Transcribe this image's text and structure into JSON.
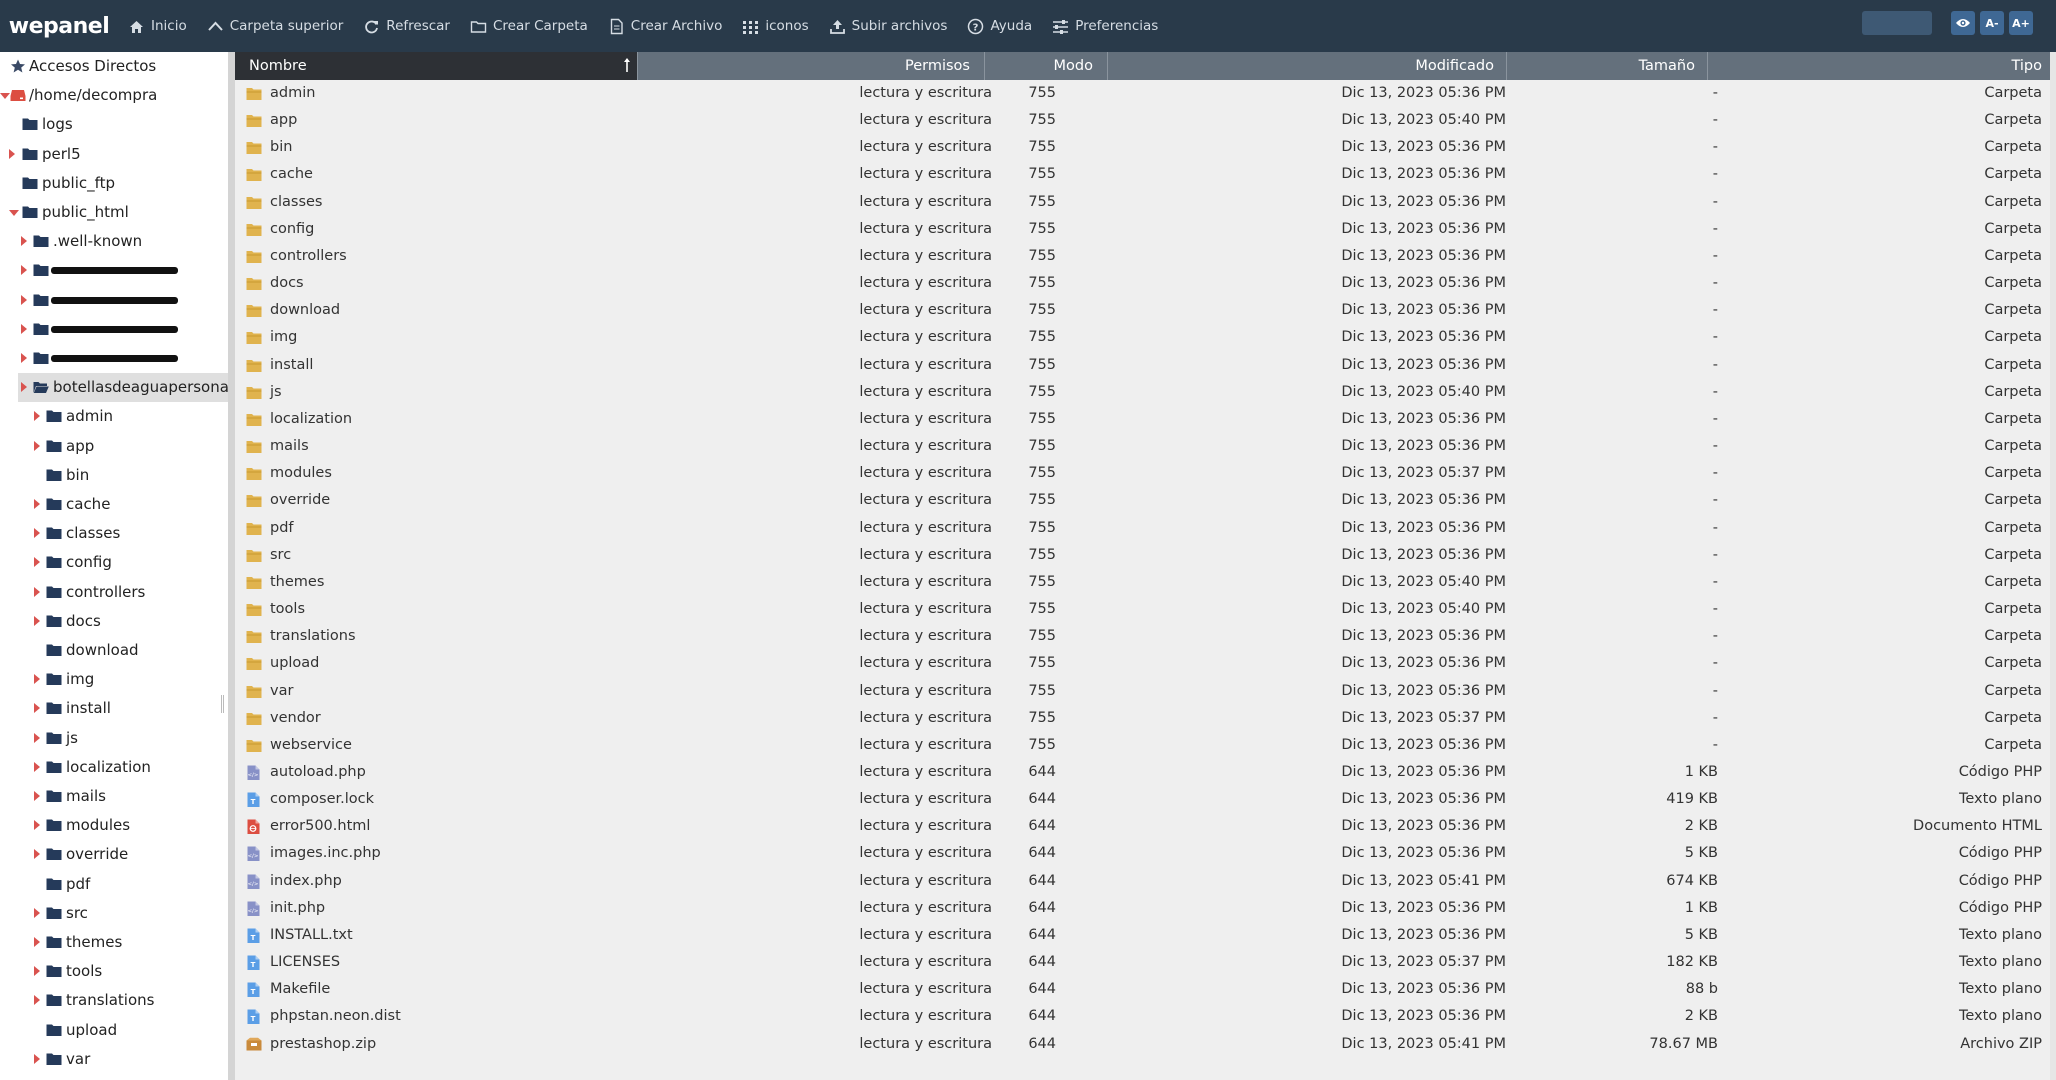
{
  "app": {
    "logo": "wepanel"
  },
  "toolbar": {
    "items": [
      {
        "label": "Inicio",
        "icon": "home-icon"
      },
      {
        "label": "Carpeta superior",
        "icon": "chevron-up-icon"
      },
      {
        "label": "Refrescar",
        "icon": "refresh-icon"
      },
      {
        "label": "Crear Carpeta",
        "icon": "folder-outline-icon"
      },
      {
        "label": "Crear Archivo",
        "icon": "file-outline-icon"
      },
      {
        "label": "iconos",
        "icon": "grid-icon"
      },
      {
        "label": "Subir archivos",
        "icon": "upload-icon"
      },
      {
        "label": "Ayuda",
        "icon": "help-icon"
      },
      {
        "label": "Preferencias",
        "icon": "sliders-icon"
      }
    ],
    "search_value": "",
    "view_button": "eye-icon",
    "font_smaller": "A-",
    "font_larger": "A+"
  },
  "colors": {
    "topbar": "#293a4a",
    "header": "#64707c",
    "folder": "#e0b34e",
    "tree_folder": "#253a5a",
    "caret": "#d9534f",
    "php": "#8891c7",
    "text": "#5b9ee6",
    "html": "#dc4e41",
    "zip": "#c98a3b"
  },
  "sidebar": {
    "items": [
      {
        "label": "Accesos Directos",
        "icon": "star-icon",
        "level": 0,
        "caret": "none"
      },
      {
        "label": "/home/decompra",
        "icon": "drive-icon",
        "level": 0,
        "caret": "down"
      },
      {
        "label": "logs",
        "icon": "folder-icon",
        "level": 1,
        "caret": "none"
      },
      {
        "label": "perl5",
        "icon": "folder-icon",
        "level": 1,
        "caret": "right"
      },
      {
        "label": "public_ftp",
        "icon": "folder-icon",
        "level": 1,
        "caret": "none"
      },
      {
        "label": "public_html",
        "icon": "folder-icon",
        "level": 1,
        "caret": "down"
      },
      {
        "label": ".well-known",
        "icon": "folder-icon",
        "level": 2,
        "caret": "right"
      },
      {
        "label": "",
        "icon": "folder-icon",
        "level": 2,
        "caret": "right",
        "redacted": true
      },
      {
        "label": "",
        "icon": "folder-icon",
        "level": 2,
        "caret": "right",
        "redacted": true
      },
      {
        "label": "",
        "icon": "folder-icon",
        "level": 2,
        "caret": "right",
        "redacted": true
      },
      {
        "label": "",
        "icon": "folder-icon",
        "level": 2,
        "caret": "right",
        "redacted": true
      },
      {
        "label": "botellasdeaguapersonaliz",
        "icon": "folder-open-icon",
        "level": 2,
        "caret": "right",
        "selected": true
      },
      {
        "label": "admin",
        "icon": "folder-icon",
        "level": 3,
        "caret": "right"
      },
      {
        "label": "app",
        "icon": "folder-icon",
        "level": 3,
        "caret": "right"
      },
      {
        "label": "bin",
        "icon": "folder-icon",
        "level": 3,
        "caret": "none"
      },
      {
        "label": "cache",
        "icon": "folder-icon",
        "level": 3,
        "caret": "right"
      },
      {
        "label": "classes",
        "icon": "folder-icon",
        "level": 3,
        "caret": "right"
      },
      {
        "label": "config",
        "icon": "folder-icon",
        "level": 3,
        "caret": "right"
      },
      {
        "label": "controllers",
        "icon": "folder-icon",
        "level": 3,
        "caret": "right"
      },
      {
        "label": "docs",
        "icon": "folder-icon",
        "level": 3,
        "caret": "right"
      },
      {
        "label": "download",
        "icon": "folder-icon",
        "level": 3,
        "caret": "none"
      },
      {
        "label": "img",
        "icon": "folder-icon",
        "level": 3,
        "caret": "right"
      },
      {
        "label": "install",
        "icon": "folder-icon",
        "level": 3,
        "caret": "right"
      },
      {
        "label": "js",
        "icon": "folder-icon",
        "level": 3,
        "caret": "right"
      },
      {
        "label": "localization",
        "icon": "folder-icon",
        "level": 3,
        "caret": "right"
      },
      {
        "label": "mails",
        "icon": "folder-icon",
        "level": 3,
        "caret": "right"
      },
      {
        "label": "modules",
        "icon": "folder-icon",
        "level": 3,
        "caret": "right"
      },
      {
        "label": "override",
        "icon": "folder-icon",
        "level": 3,
        "caret": "right"
      },
      {
        "label": "pdf",
        "icon": "folder-icon",
        "level": 3,
        "caret": "none"
      },
      {
        "label": "src",
        "icon": "folder-icon",
        "level": 3,
        "caret": "right"
      },
      {
        "label": "themes",
        "icon": "folder-icon",
        "level": 3,
        "caret": "right"
      },
      {
        "label": "tools",
        "icon": "folder-icon",
        "level": 3,
        "caret": "right"
      },
      {
        "label": "translations",
        "icon": "folder-icon",
        "level": 3,
        "caret": "right"
      },
      {
        "label": "upload",
        "icon": "folder-icon",
        "level": 3,
        "caret": "none"
      },
      {
        "label": "var",
        "icon": "folder-icon",
        "level": 3,
        "caret": "right"
      }
    ]
  },
  "table": {
    "columns": [
      "Nombre",
      "Permisos",
      "Modo",
      "Modificado",
      "Tamaño",
      "Tipo"
    ],
    "sort": {
      "column": "Nombre",
      "direction": "asc"
    },
    "rows": [
      {
        "name": "admin",
        "kind": "folder",
        "perm": "lectura y escritura",
        "mode": "755",
        "modified": "Dic 13, 2023 05:36 PM",
        "size": "-",
        "type": "Carpeta"
      },
      {
        "name": "app",
        "kind": "folder",
        "perm": "lectura y escritura",
        "mode": "755",
        "modified": "Dic 13, 2023 05:40 PM",
        "size": "-",
        "type": "Carpeta"
      },
      {
        "name": "bin",
        "kind": "folder",
        "perm": "lectura y escritura",
        "mode": "755",
        "modified": "Dic 13, 2023 05:36 PM",
        "size": "-",
        "type": "Carpeta"
      },
      {
        "name": "cache",
        "kind": "folder",
        "perm": "lectura y escritura",
        "mode": "755",
        "modified": "Dic 13, 2023 05:36 PM",
        "size": "-",
        "type": "Carpeta"
      },
      {
        "name": "classes",
        "kind": "folder",
        "perm": "lectura y escritura",
        "mode": "755",
        "modified": "Dic 13, 2023 05:36 PM",
        "size": "-",
        "type": "Carpeta"
      },
      {
        "name": "config",
        "kind": "folder",
        "perm": "lectura y escritura",
        "mode": "755",
        "modified": "Dic 13, 2023 05:36 PM",
        "size": "-",
        "type": "Carpeta"
      },
      {
        "name": "controllers",
        "kind": "folder",
        "perm": "lectura y escritura",
        "mode": "755",
        "modified": "Dic 13, 2023 05:36 PM",
        "size": "-",
        "type": "Carpeta"
      },
      {
        "name": "docs",
        "kind": "folder",
        "perm": "lectura y escritura",
        "mode": "755",
        "modified": "Dic 13, 2023 05:36 PM",
        "size": "-",
        "type": "Carpeta"
      },
      {
        "name": "download",
        "kind": "folder",
        "perm": "lectura y escritura",
        "mode": "755",
        "modified": "Dic 13, 2023 05:36 PM",
        "size": "-",
        "type": "Carpeta"
      },
      {
        "name": "img",
        "kind": "folder",
        "perm": "lectura y escritura",
        "mode": "755",
        "modified": "Dic 13, 2023 05:36 PM",
        "size": "-",
        "type": "Carpeta"
      },
      {
        "name": "install",
        "kind": "folder",
        "perm": "lectura y escritura",
        "mode": "755",
        "modified": "Dic 13, 2023 05:36 PM",
        "size": "-",
        "type": "Carpeta"
      },
      {
        "name": "js",
        "kind": "folder",
        "perm": "lectura y escritura",
        "mode": "755",
        "modified": "Dic 13, 2023 05:40 PM",
        "size": "-",
        "type": "Carpeta"
      },
      {
        "name": "localization",
        "kind": "folder",
        "perm": "lectura y escritura",
        "mode": "755",
        "modified": "Dic 13, 2023 05:36 PM",
        "size": "-",
        "type": "Carpeta"
      },
      {
        "name": "mails",
        "kind": "folder",
        "perm": "lectura y escritura",
        "mode": "755",
        "modified": "Dic 13, 2023 05:36 PM",
        "size": "-",
        "type": "Carpeta"
      },
      {
        "name": "modules",
        "kind": "folder",
        "perm": "lectura y escritura",
        "mode": "755",
        "modified": "Dic 13, 2023 05:37 PM",
        "size": "-",
        "type": "Carpeta"
      },
      {
        "name": "override",
        "kind": "folder",
        "perm": "lectura y escritura",
        "mode": "755",
        "modified": "Dic 13, 2023 05:36 PM",
        "size": "-",
        "type": "Carpeta"
      },
      {
        "name": "pdf",
        "kind": "folder",
        "perm": "lectura y escritura",
        "mode": "755",
        "modified": "Dic 13, 2023 05:36 PM",
        "size": "-",
        "type": "Carpeta"
      },
      {
        "name": "src",
        "kind": "folder",
        "perm": "lectura y escritura",
        "mode": "755",
        "modified": "Dic 13, 2023 05:36 PM",
        "size": "-",
        "type": "Carpeta"
      },
      {
        "name": "themes",
        "kind": "folder",
        "perm": "lectura y escritura",
        "mode": "755",
        "modified": "Dic 13, 2023 05:40 PM",
        "size": "-",
        "type": "Carpeta"
      },
      {
        "name": "tools",
        "kind": "folder",
        "perm": "lectura y escritura",
        "mode": "755",
        "modified": "Dic 13, 2023 05:40 PM",
        "size": "-",
        "type": "Carpeta"
      },
      {
        "name": "translations",
        "kind": "folder",
        "perm": "lectura y escritura",
        "mode": "755",
        "modified": "Dic 13, 2023 05:36 PM",
        "size": "-",
        "type": "Carpeta"
      },
      {
        "name": "upload",
        "kind": "folder",
        "perm": "lectura y escritura",
        "mode": "755",
        "modified": "Dic 13, 2023 05:36 PM",
        "size": "-",
        "type": "Carpeta"
      },
      {
        "name": "var",
        "kind": "folder",
        "perm": "lectura y escritura",
        "mode": "755",
        "modified": "Dic 13, 2023 05:36 PM",
        "size": "-",
        "type": "Carpeta"
      },
      {
        "name": "vendor",
        "kind": "folder",
        "perm": "lectura y escritura",
        "mode": "755",
        "modified": "Dic 13, 2023 05:37 PM",
        "size": "-",
        "type": "Carpeta"
      },
      {
        "name": "webservice",
        "kind": "folder",
        "perm": "lectura y escritura",
        "mode": "755",
        "modified": "Dic 13, 2023 05:36 PM",
        "size": "-",
        "type": "Carpeta"
      },
      {
        "name": "autoload.php",
        "kind": "php",
        "perm": "lectura y escritura",
        "mode": "644",
        "modified": "Dic 13, 2023 05:36 PM",
        "size": "1 KB",
        "type": "Código PHP"
      },
      {
        "name": "composer.lock",
        "kind": "text",
        "perm": "lectura y escritura",
        "mode": "644",
        "modified": "Dic 13, 2023 05:36 PM",
        "size": "419 KB",
        "type": "Texto plano"
      },
      {
        "name": "error500.html",
        "kind": "html",
        "perm": "lectura y escritura",
        "mode": "644",
        "modified": "Dic 13, 2023 05:36 PM",
        "size": "2 KB",
        "type": "Documento HTML"
      },
      {
        "name": "images.inc.php",
        "kind": "php",
        "perm": "lectura y escritura",
        "mode": "644",
        "modified": "Dic 13, 2023 05:36 PM",
        "size": "5 KB",
        "type": "Código PHP"
      },
      {
        "name": "index.php",
        "kind": "php",
        "perm": "lectura y escritura",
        "mode": "644",
        "modified": "Dic 13, 2023 05:41 PM",
        "size": "674 KB",
        "type": "Código PHP"
      },
      {
        "name": "init.php",
        "kind": "php",
        "perm": "lectura y escritura",
        "mode": "644",
        "modified": "Dic 13, 2023 05:36 PM",
        "size": "1 KB",
        "type": "Código PHP"
      },
      {
        "name": "INSTALL.txt",
        "kind": "text",
        "perm": "lectura y escritura",
        "mode": "644",
        "modified": "Dic 13, 2023 05:36 PM",
        "size": "5 KB",
        "type": "Texto plano"
      },
      {
        "name": "LICENSES",
        "kind": "text",
        "perm": "lectura y escritura",
        "mode": "644",
        "modified": "Dic 13, 2023 05:37 PM",
        "size": "182 KB",
        "type": "Texto plano"
      },
      {
        "name": "Makefile",
        "kind": "text",
        "perm": "lectura y escritura",
        "mode": "644",
        "modified": "Dic 13, 2023 05:36 PM",
        "size": "88 b",
        "type": "Texto plano"
      },
      {
        "name": "phpstan.neon.dist",
        "kind": "text",
        "perm": "lectura y escritura",
        "mode": "644",
        "modified": "Dic 13, 2023 05:36 PM",
        "size": "2 KB",
        "type": "Texto plano"
      },
      {
        "name": "prestashop.zip",
        "kind": "zip",
        "perm": "lectura y escritura",
        "mode": "644",
        "modified": "Dic 13, 2023 05:41 PM",
        "size": "78.67 MB",
        "type": "Archivo ZIP"
      }
    ]
  }
}
